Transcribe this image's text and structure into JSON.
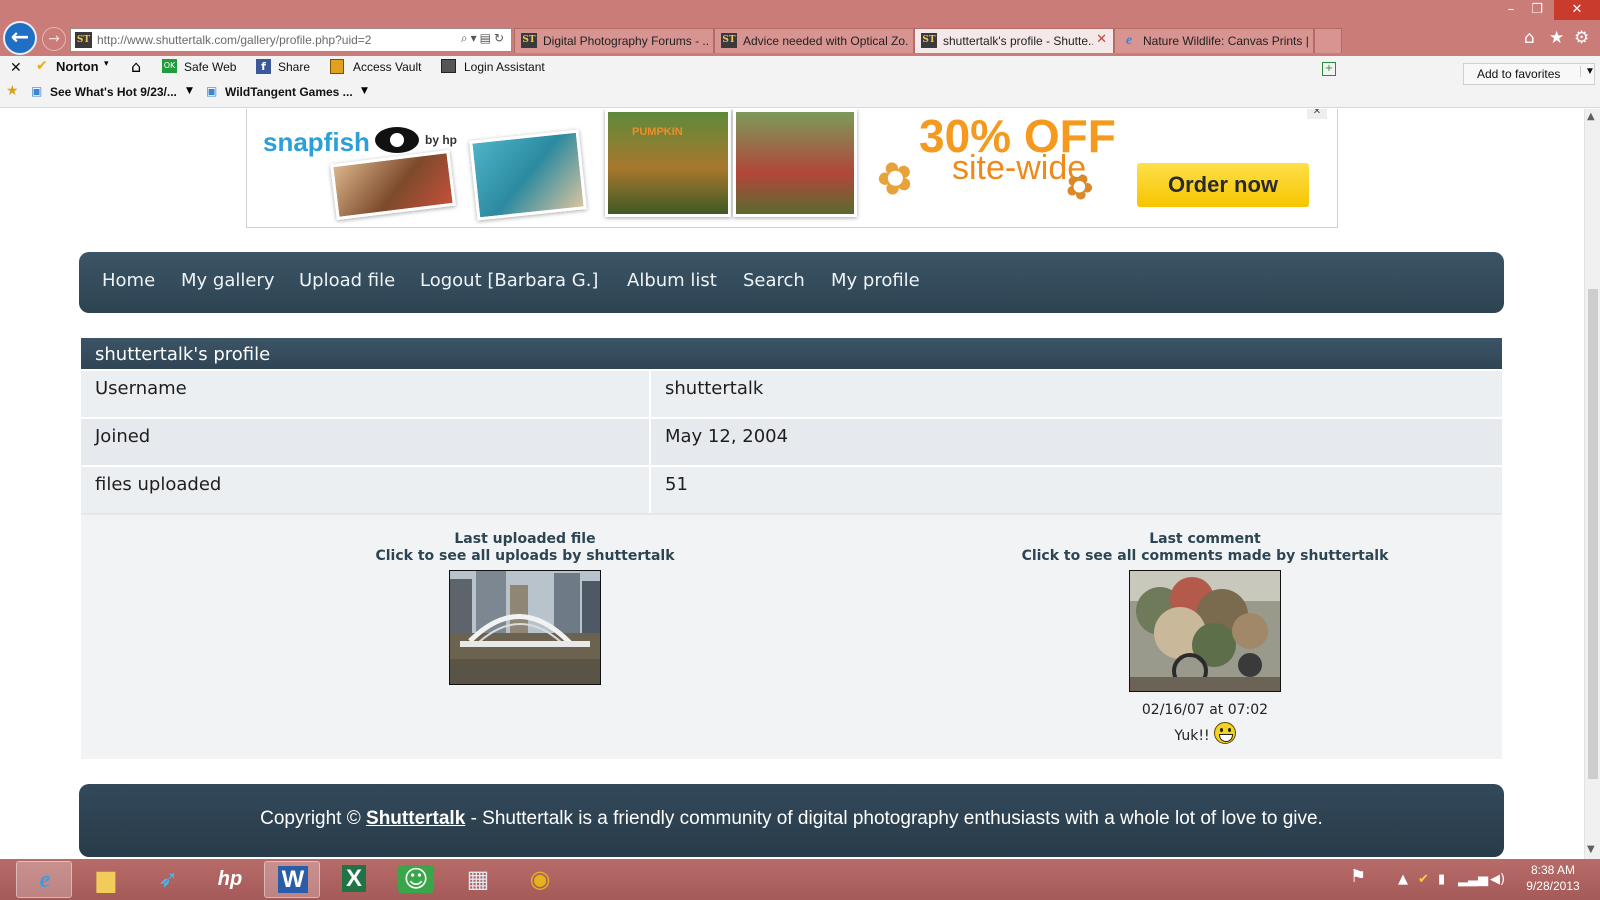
{
  "browser": {
    "address_url": "http://www.shuttertalk.com/gallery/profile.php?uid=2",
    "favicon_text": "ST",
    "tabs": [
      {
        "label": "Digital Photography Forums - ...",
        "icon": "shuttertalk-favicon"
      },
      {
        "label": "Advice needed with Optical Zo...",
        "icon": "shuttertalk-favicon"
      },
      {
        "label": "shuttertalk's profile - Shutte...",
        "icon": "shuttertalk-favicon",
        "active": true
      },
      {
        "label": "Nature Wildlife: Canvas Prints |...",
        "icon": "ie-favicon"
      }
    ],
    "toolbar": {
      "norton": "Norton",
      "safe_web": "Safe Web",
      "share": "Share",
      "access_vault": "Access Vault",
      "login_assistant": "Login Assistant",
      "add_to_favorites": "Add to favorites"
    },
    "favorites_bar": [
      {
        "label": "See What's Hot 9/23/..."
      },
      {
        "label": "WildTangent Games ..."
      }
    ]
  },
  "ad": {
    "brand": "snapfish",
    "by": "by hp",
    "headline": "30% OFF",
    "subline": "site-wide",
    "cta": "Order now",
    "photo_caption": "PUMPKIN",
    "close_glyph": "✕"
  },
  "nav": {
    "items": [
      "Home",
      "My gallery",
      "Upload file",
      "Logout [Barbara G.]",
      "Album list",
      "Search",
      "My profile"
    ]
  },
  "profile": {
    "title": "shuttertalk's profile",
    "rows": [
      {
        "label": "Username",
        "value": "shuttertalk"
      },
      {
        "label": "Joined",
        "value": "May 12, 2004"
      },
      {
        "label": "files uploaded",
        "value": "51"
      }
    ],
    "last_upload": {
      "heading": "Last uploaded file",
      "link": "Click to see all uploads by shuttertalk"
    },
    "last_comment": {
      "heading": "Last comment",
      "link": "Click to see all comments made by shuttertalk",
      "date": "02/16/07 at 07:02",
      "text": "Yuk!!"
    }
  },
  "footer": {
    "prefix": "Copyright ©",
    "site_link": "Shuttertalk",
    "suffix": "- Shuttertalk is a friendly community of digital photography enthusiasts with a whole lot of love to give."
  },
  "taskbar": {
    "time": "8:38 AM",
    "date": "9/28/2013",
    "apps": [
      "internet-explorer",
      "file-explorer",
      "hp-launcher",
      "hp",
      "word",
      "excel",
      "messenger",
      "calculator",
      "chrome"
    ]
  },
  "colors": {
    "chrome": "#c97c78",
    "nav_bg": "#334a5a",
    "row_bg": "#eceff2",
    "link_text": "#2d4552",
    "ad_orange": "#f39a1f",
    "taskbar": "#b86c6a"
  }
}
